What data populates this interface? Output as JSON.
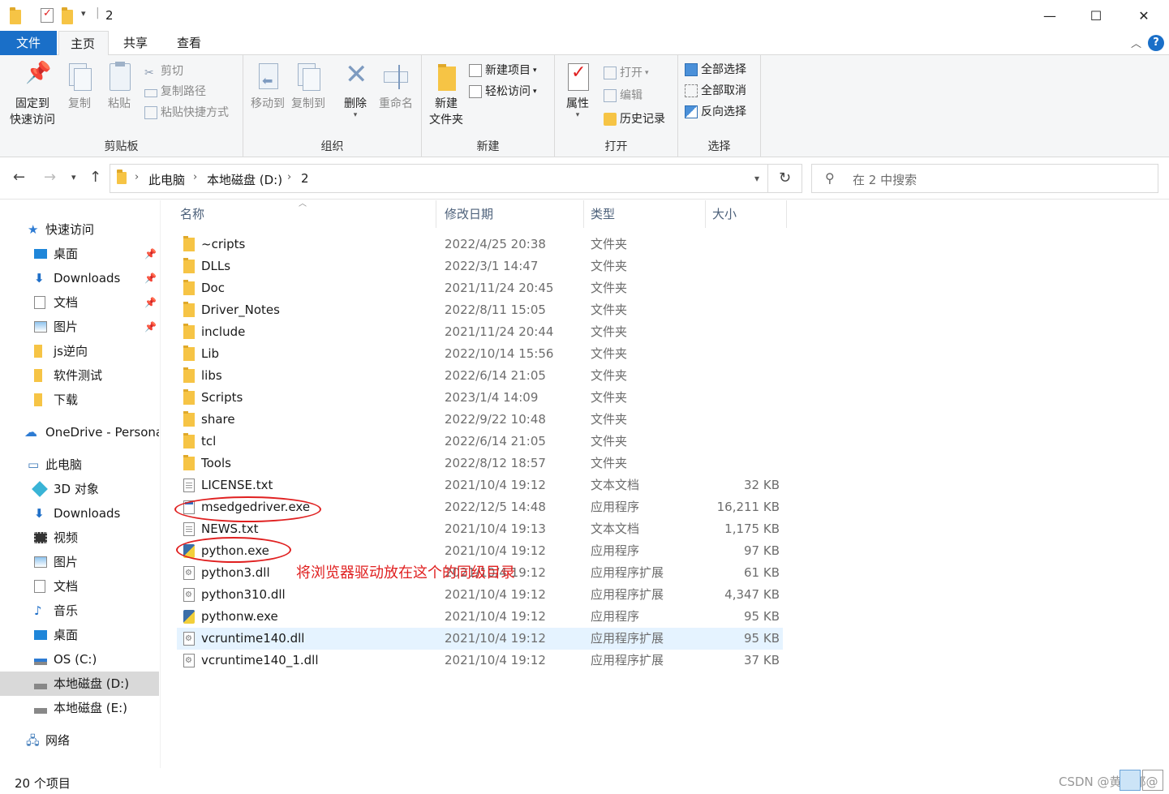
{
  "window": {
    "title": "2",
    "minimize": "—",
    "maximize": "☐",
    "close": "✕"
  },
  "tabs": [
    {
      "label": "文件"
    },
    {
      "label": "主页"
    },
    {
      "label": "共享"
    },
    {
      "label": "查看"
    }
  ],
  "help_label": "?",
  "ribbon": {
    "clipboard": {
      "label": "剪贴板",
      "pin_line1": "固定到",
      "pin_line2": "快速访问",
      "copy": "复制",
      "paste": "粘贴",
      "cut": "剪切",
      "copy_path": "复制路径",
      "paste_shortcut": "粘贴快捷方式"
    },
    "organize": {
      "label": "组织",
      "move_to": "移动到",
      "copy_to": "复制到",
      "delete": "删除",
      "rename": "重命名"
    },
    "new": {
      "label": "新建",
      "new_folder_line1": "新建",
      "new_folder_line2": "文件夹",
      "new_item": "新建项目",
      "easy_access": "轻松访问"
    },
    "open": {
      "label": "打开",
      "properties": "属性",
      "open": "打开",
      "edit": "编辑",
      "history": "历史记录"
    },
    "select": {
      "label": "选择",
      "select_all": "全部选择",
      "select_none": "全部取消",
      "invert": "反向选择"
    }
  },
  "address": {
    "crumbs": [
      "此电脑",
      "本地磁盘 (D:)",
      "2"
    ],
    "search_placeholder": "在 2 中搜索"
  },
  "sidebar": {
    "quick_access": "快速访问",
    "quick_items": [
      {
        "label": "桌面",
        "pinned": true
      },
      {
        "label": "Downloads",
        "pinned": true
      },
      {
        "label": "文档",
        "pinned": true
      },
      {
        "label": "图片",
        "pinned": true
      },
      {
        "label": "js逆向",
        "pinned": false
      },
      {
        "label": "软件测试",
        "pinned": false
      },
      {
        "label": "下载",
        "pinned": false
      }
    ],
    "onedrive": "OneDrive - Persona",
    "this_pc": "此电脑",
    "pc_items": [
      {
        "label": "3D 对象"
      },
      {
        "label": "Downloads"
      },
      {
        "label": "视频"
      },
      {
        "label": "图片"
      },
      {
        "label": "文档"
      },
      {
        "label": "音乐"
      },
      {
        "label": "桌面"
      },
      {
        "label": "OS (C:)"
      },
      {
        "label": "本地磁盘 (D:)"
      },
      {
        "label": "本地磁盘 (E:)"
      }
    ],
    "network": "网络"
  },
  "columns": {
    "name": "名称",
    "date": "修改日期",
    "type": "类型",
    "size": "大小"
  },
  "files": [
    {
      "name": "~cripts",
      "date": "2022/4/25 20:38",
      "type": "文件夹",
      "size": "",
      "icon": "folder"
    },
    {
      "name": "DLLs",
      "date": "2022/3/1 14:47",
      "type": "文件夹",
      "size": "",
      "icon": "folder"
    },
    {
      "name": "Doc",
      "date": "2021/11/24 20:45",
      "type": "文件夹",
      "size": "",
      "icon": "folder"
    },
    {
      "name": "Driver_Notes",
      "date": "2022/8/11 15:05",
      "type": "文件夹",
      "size": "",
      "icon": "folder"
    },
    {
      "name": "include",
      "date": "2021/11/24 20:44",
      "type": "文件夹",
      "size": "",
      "icon": "folder"
    },
    {
      "name": "Lib",
      "date": "2022/10/14 15:56",
      "type": "文件夹",
      "size": "",
      "icon": "folder"
    },
    {
      "name": "libs",
      "date": "2022/6/14 21:05",
      "type": "文件夹",
      "size": "",
      "icon": "folder"
    },
    {
      "name": "Scripts",
      "date": "2023/1/4 14:09",
      "type": "文件夹",
      "size": "",
      "icon": "folder"
    },
    {
      "name": "share",
      "date": "2022/9/22 10:48",
      "type": "文件夹",
      "size": "",
      "icon": "folder"
    },
    {
      "name": "tcl",
      "date": "2022/6/14 21:05",
      "type": "文件夹",
      "size": "",
      "icon": "folder"
    },
    {
      "name": "Tools",
      "date": "2022/8/12 18:57",
      "type": "文件夹",
      "size": "",
      "icon": "folder"
    },
    {
      "name": "LICENSE.txt",
      "date": "2021/10/4 19:12",
      "type": "文本文档",
      "size": "32 KB",
      "icon": "doc"
    },
    {
      "name": "msedgedriver.exe",
      "date": "2022/12/5 14:48",
      "type": "应用程序",
      "size": "16,211 KB",
      "icon": "exe"
    },
    {
      "name": "NEWS.txt",
      "date": "2021/10/4 19:13",
      "type": "文本文档",
      "size": "1,175 KB",
      "icon": "doc"
    },
    {
      "name": "python.exe",
      "date": "2021/10/4 19:12",
      "type": "应用程序",
      "size": "97 KB",
      "icon": "py"
    },
    {
      "name": "python3.dll",
      "date": "2021/10/4 19:12",
      "type": "应用程序扩展",
      "size": "61 KB",
      "icon": "dll"
    },
    {
      "name": "python310.dll",
      "date": "2021/10/4 19:12",
      "type": "应用程序扩展",
      "size": "4,347 KB",
      "icon": "dll"
    },
    {
      "name": "pythonw.exe",
      "date": "2021/10/4 19:12",
      "type": "应用程序",
      "size": "95 KB",
      "icon": "py"
    },
    {
      "name": "vcruntime140.dll",
      "date": "2021/10/4 19:12",
      "type": "应用程序扩展",
      "size": "95 KB",
      "icon": "dll",
      "highlighted": true
    },
    {
      "name": "vcruntime140_1.dll",
      "date": "2021/10/4 19:12",
      "type": "应用程序扩展",
      "size": "37 KB",
      "icon": "dll"
    }
  ],
  "annotation": "将浏览器驱动放在这个的同级目录",
  "status": {
    "count": "20 个项目",
    "watermark": "CSDN @黄小耶@"
  }
}
